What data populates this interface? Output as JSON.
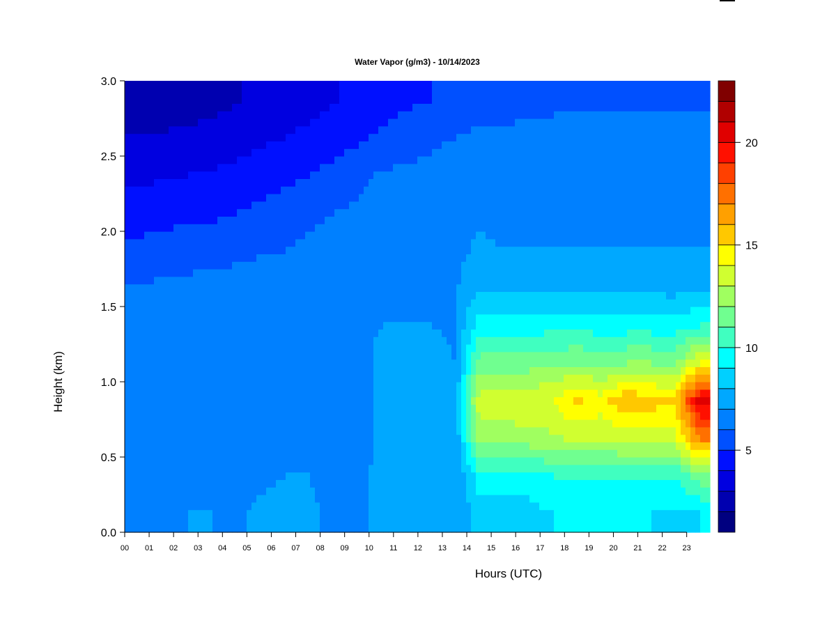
{
  "chart_data": {
    "type": "heatmap",
    "title": "Water Vapor (g/m3) - 10/14/2023",
    "xlabel": "Hours (UTC)",
    "ylabel": "Height (km)",
    "xlim": [
      0,
      23.95
    ],
    "ylim": [
      0,
      3.0
    ],
    "x_tick_values": [
      0,
      1,
      2,
      3,
      4,
      5,
      6,
      7,
      8,
      9,
      10,
      11,
      12,
      13,
      14,
      15,
      16,
      17,
      18,
      19,
      20,
      21,
      22,
      23
    ],
    "x_tick_labels": [
      "00",
      "01",
      "02",
      "03",
      "04",
      "05",
      "06",
      "07",
      "08",
      "09",
      "10",
      "11",
      "12",
      "13",
      "14",
      "15",
      "16",
      "17",
      "18",
      "19",
      "20",
      "21",
      "22",
      "23"
    ],
    "y_tick_values": [
      0.0,
      0.5,
      1.0,
      1.5,
      2.0,
      2.5,
      3.0
    ],
    "y_tick_labels": [
      "0.0",
      "0.5",
      "1.0",
      "1.5",
      "2.0",
      "2.5",
      "3.0"
    ],
    "x_hours": [
      0.5,
      1.5,
      2.5,
      3.5,
      4.5,
      5.5,
      6.5,
      7.5,
      8.5,
      9.5,
      10.5,
      11.5,
      12.5,
      13.5,
      14.5,
      15.5,
      16.5,
      17.5,
      18.5,
      19.5,
      20.5,
      21.5,
      22.5,
      23.5
    ],
    "y_heights_km": [
      0.125,
      0.375,
      0.625,
      0.875,
      1.125,
      1.375,
      1.625,
      1.875,
      2.125,
      2.375,
      2.625,
      2.875
    ],
    "values_by_hour": [
      [
        6.5,
        6.5,
        6.3,
        6.3,
        6.3,
        6.2,
        6.0,
        5.3,
        4.5,
        3.8,
        3.0,
        2.5
      ],
      [
        6.5,
        6.8,
        6.5,
        6.5,
        6.5,
        6.5,
        6.2,
        5.4,
        4.6,
        3.9,
        3.1,
        2.5
      ],
      [
        7.0,
        6.8,
        6.6,
        6.6,
        6.6,
        6.6,
        6.3,
        5.5,
        4.8,
        4.0,
        3.2,
        2.6
      ],
      [
        7.0,
        6.8,
        6.6,
        6.6,
        6.6,
        6.6,
        6.4,
        5.6,
        4.8,
        4.1,
        3.3,
        2.7
      ],
      [
        6.8,
        6.6,
        6.6,
        6.6,
        6.6,
        6.6,
        6.5,
        5.7,
        5.0,
        4.3,
        3.5,
        2.9
      ],
      [
        7.2,
        6.8,
        6.8,
        6.8,
        6.8,
        6.7,
        6.5,
        5.9,
        5.2,
        4.5,
        3.8,
        3.2
      ],
      [
        7.4,
        7.0,
        7.0,
        7.0,
        7.0,
        6.8,
        6.6,
        6.0,
        5.5,
        4.7,
        4.0,
        3.5
      ],
      [
        7.2,
        7.0,
        6.9,
        6.9,
        6.9,
        6.8,
        6.6,
        6.2,
        5.8,
        5.0,
        4.2,
        3.7
      ],
      [
        6.8,
        6.8,
        6.8,
        6.8,
        6.8,
        6.7,
        6.6,
        6.3,
        6.0,
        5.3,
        4.5,
        3.9
      ],
      [
        6.6,
        6.5,
        6.6,
        6.6,
        6.6,
        6.8,
        6.8,
        6.5,
        6.2,
        5.7,
        4.8,
        4.2
      ],
      [
        7.6,
        7.4,
        7.2,
        7.2,
        7.2,
        7.0,
        6.9,
        6.6,
        6.4,
        6.1,
        5.2,
        4.5
      ],
      [
        7.6,
        7.4,
        7.3,
        7.4,
        7.2,
        7.0,
        6.9,
        6.7,
        6.5,
        6.2,
        5.5,
        4.8
      ],
      [
        7.2,
        7.2,
        7.3,
        7.6,
        7.4,
        7.0,
        6.9,
        6.7,
        6.6,
        6.3,
        5.8,
        5.0
      ],
      [
        7.0,
        7.0,
        7.0,
        7.2,
        7.0,
        6.9,
        6.8,
        6.7,
        6.6,
        6.4,
        6.0,
        5.3
      ],
      [
        8.5,
        9.5,
        12.5,
        13.5,
        11.5,
        9.5,
        8.0,
        7.2,
        6.8,
        6.6,
        6.2,
        5.6
      ],
      [
        8.5,
        9.5,
        12.5,
        13.5,
        11.5,
        9.5,
        7.8,
        7.0,
        6.8,
        6.6,
        6.2,
        5.6
      ],
      [
        8.6,
        9.6,
        12.6,
        13.8,
        11.5,
        9.5,
        7.8,
        7.0,
        6.8,
        6.6,
        6.3,
        5.7
      ],
      [
        9.0,
        10.0,
        12.8,
        14.0,
        11.8,
        9.6,
        7.8,
        7.0,
        6.8,
        6.6,
        6.3,
        5.8
      ],
      [
        9.2,
        10.2,
        13.2,
        15.2,
        12.0,
        9.6,
        7.8,
        7.0,
        6.8,
        6.6,
        6.3,
        5.8
      ],
      [
        9.2,
        10.0,
        13.0,
        14.5,
        11.8,
        9.5,
        7.7,
        7.0,
        6.8,
        6.6,
        6.3,
        5.8
      ],
      [
        9.0,
        10.0,
        13.5,
        16.0,
        12.0,
        9.5,
        7.7,
        7.0,
        6.8,
        6.6,
        6.3,
        5.8
      ],
      [
        9.0,
        10.0,
        13.5,
        15.5,
        12.0,
        9.5,
        7.7,
        7.0,
        6.8,
        6.6,
        6.3,
        5.8
      ],
      [
        8.8,
        10.0,
        13.5,
        15.0,
        11.8,
        9.4,
        7.6,
        7.0,
        6.8,
        6.6,
        6.3,
        5.8
      ],
      [
        9.0,
        11.5,
        17.0,
        20.5,
        14.0,
        10.0,
        7.8,
        7.0,
        6.8,
        6.6,
        6.3,
        5.8
      ]
    ],
    "colorbar": {
      "levels": [
        1,
        2,
        3,
        4,
        5,
        6,
        7,
        8,
        9,
        10,
        11,
        12,
        13,
        14,
        15,
        16,
        17,
        18,
        19,
        20,
        21,
        22,
        23
      ],
      "colors": [
        "#000080",
        "#0000B0",
        "#0000E0",
        "#0010FF",
        "#0050FF",
        "#0080FF",
        "#00A8FF",
        "#00D0FF",
        "#00FFFF",
        "#40FFC0",
        "#70FF90",
        "#A0FF60",
        "#D0FF30",
        "#FFFF00",
        "#FFC800",
        "#FFA000",
        "#FF7000",
        "#FF4000",
        "#FF1000",
        "#E00000",
        "#B00000",
        "#800000"
      ],
      "tick_values": [
        5,
        10,
        15,
        20
      ],
      "tick_labels": [
        "5",
        "10",
        "15",
        "20"
      ]
    }
  }
}
